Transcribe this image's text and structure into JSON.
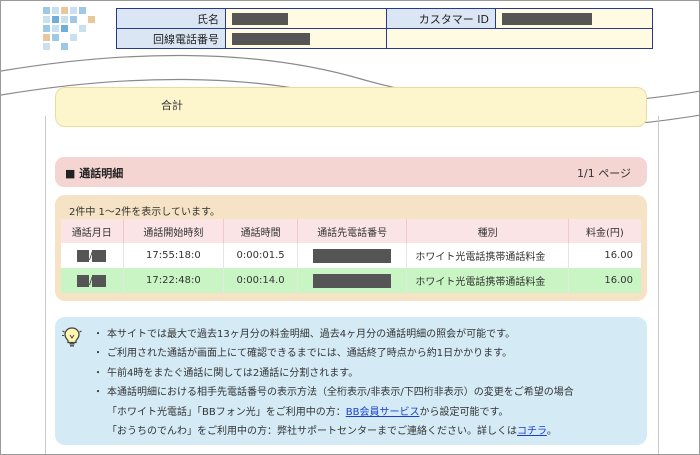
{
  "header": {
    "name_label": "氏名",
    "customer_id_label": "カスタマー ID",
    "line_number_label": "回線電話番号"
  },
  "total": {
    "label": "合計"
  },
  "detail": {
    "title": "■ 通話明細",
    "page_indicator": "1/1 ページ",
    "count_text": "2件中 1～2件を表示しています。",
    "columns": [
      "通話月日",
      "通話開始時刻",
      "通話時間",
      "通話先電話番号",
      "種別",
      "料金(円)"
    ],
    "rows": [
      {
        "date_sep": "/",
        "start": "17:55:18:0",
        "duration": "0:00:01.5",
        "type": "ホワイト光電話携帯通話料金",
        "fee": "16.00"
      },
      {
        "date_sep": "/",
        "start": "17:22:48:0",
        "duration": "0:00:14.0",
        "type": "ホワイト光電話携帯通話料金",
        "fee": "16.00"
      }
    ]
  },
  "notes": {
    "items": [
      "本サイトでは最大で過去13ヶ月分の料金明細、過去4ヶ月分の通話明細の照会が可能です。",
      "ご利用された通話が画面上にて確認できるまでには、通話終了時点から約1日かかります。",
      "午前4時をまたぐ通話に関しては2通話に分割されます。",
      "本通話明細における相手先電話番号の表示方法（全桁表示/非表示/下四桁非表示）の変更をご希望の場合"
    ],
    "sub1_prefix": "「ホワイト光電話」「BBフォン光」をご利用中の方：",
    "sub1_link": "BB会員サービス",
    "sub1_suffix": "から設定可能です。",
    "sub2_prefix": "「おうちのでんわ」をご利用中の方：弊社サポートセンターまでご連絡ください。詳しくは",
    "sub2_link": "コチラ",
    "sub2_suffix": "。"
  },
  "colors": {
    "header_border": "#2a3a8a",
    "detail_header_bg": "#f5d5d2",
    "list_panel_bg": "#f6e2c4",
    "highlight_row_bg": "#c9f5c5",
    "note_panel_bg": "#d4ebf6",
    "link": "#1a3fd0"
  },
  "icons": [
    "logo-mosaic",
    "lightbulb-icon"
  ]
}
